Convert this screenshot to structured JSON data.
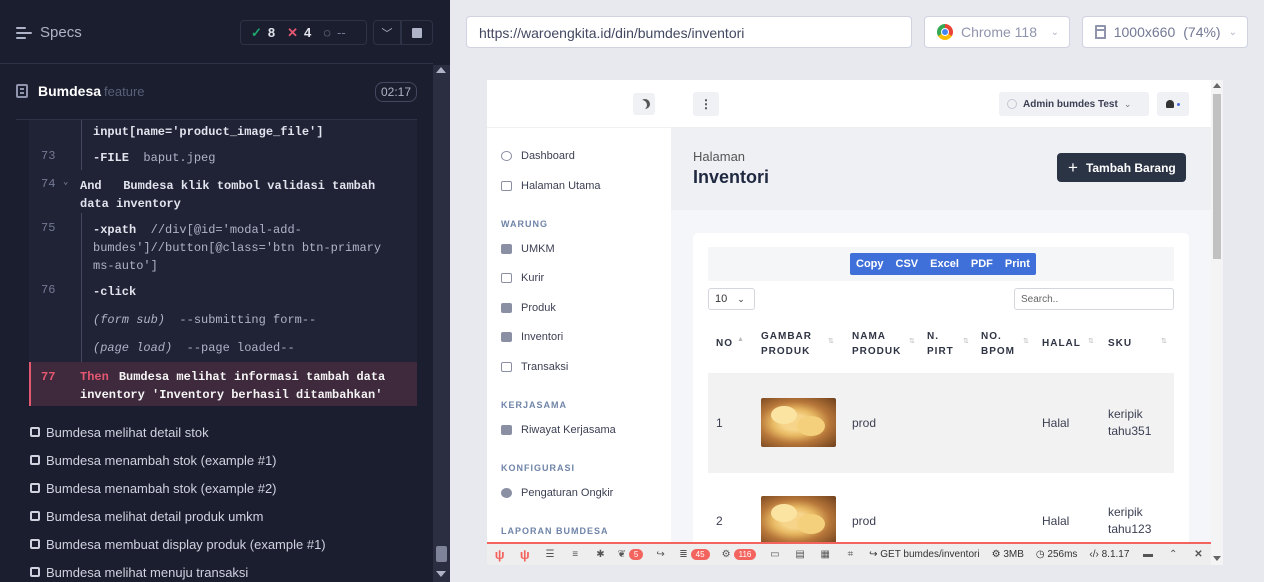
{
  "reporter": {
    "specs_label": "Specs",
    "stats": {
      "passed": "8",
      "failed": "4",
      "pending": "--"
    },
    "suite": {
      "title": "Bumdesa",
      "tag": "feature",
      "duration": "02:17"
    },
    "commands": [
      {
        "num": "",
        "text": "input[name='product_image_file']"
      },
      {
        "num": "73",
        "keyword": "-FILE",
        "arg": "baput.jpeg"
      },
      {
        "num": "74",
        "keyword": "And",
        "text": "Bumdesa klik tombol validasi tambah data inventory"
      },
      {
        "num": "75",
        "keyword": "-xpath",
        "arg": "//div[@id='modal-add-bumdes']//button[@class='btn btn-primary ms-auto']"
      },
      {
        "num": "76",
        "keyword": "-click"
      },
      {
        "num": "",
        "italic": "(form sub)",
        "arg": "--submitting form--"
      },
      {
        "num": "",
        "italic": "(page load)",
        "arg": "--page loaded--"
      }
    ],
    "failed_step": {
      "num": "77",
      "keyword": "Then",
      "text": "Bumdesa melihat informasi tambah data inventory 'Inventory berhasil ditambahkan'"
    },
    "tests": [
      "Bumdesa melihat detail stok",
      "Bumdesa menambah stok (example #1)",
      "Bumdesa menambah stok (example #2)",
      "Bumdesa melihat detail produk umkm",
      "Bumdesa membuat display produk (example #1)",
      "Bumdesa melihat menuju transaksi"
    ]
  },
  "browser": {
    "url": "https://waroengkita.id/din/bumdes/inventori",
    "browser_name": "Chrome 118",
    "viewport": "1000x660",
    "zoom": "(74%)"
  },
  "app": {
    "user_name": "Admin bumdes Test",
    "sidebar": {
      "top_items": [
        "Dashboard",
        "Halaman Utama"
      ],
      "sections": [
        {
          "title": "WARUNG",
          "items": [
            "UMKM",
            "Kurir",
            "Produk",
            "Inventori",
            "Transaksi"
          ]
        },
        {
          "title": "KERJASAMA",
          "items": [
            "Riwayat Kerjasama"
          ]
        },
        {
          "title": "KONFIGURASI",
          "items": [
            "Pengaturan Ongkir"
          ]
        },
        {
          "title": "LAPORAN BUMDESA",
          "items": []
        }
      ]
    },
    "page": {
      "subtitle": "Halaman",
      "title": "Inventori",
      "add_button": "Tambah Barang"
    },
    "table": {
      "export_buttons": [
        "Copy",
        "CSV",
        "Excel",
        "PDF",
        "Print"
      ],
      "page_length": "10",
      "search_placeholder": "Search..",
      "columns": [
        "NO",
        "GAMBAR PRODUK",
        "NAMA PRODUK",
        "N. PIRT",
        "NO. BPOM",
        "HALAL",
        "SKU"
      ],
      "rows": [
        {
          "no": "1",
          "name": "prod",
          "pirt": "",
          "bpom": "",
          "halal": "Halal",
          "sku": "keripik tahu351"
        },
        {
          "no": "2",
          "name": "prod",
          "pirt": "",
          "bpom": "",
          "halal": "Halal",
          "sku": "keripik tahu123"
        }
      ]
    },
    "debugbar": {
      "badge_messages": "5",
      "badge_queries": "45",
      "badge_models": "116",
      "route": "GET bumdes/inventori",
      "memory": "3MB",
      "time": "256ms",
      "php_version": "8.1.17"
    }
  }
}
